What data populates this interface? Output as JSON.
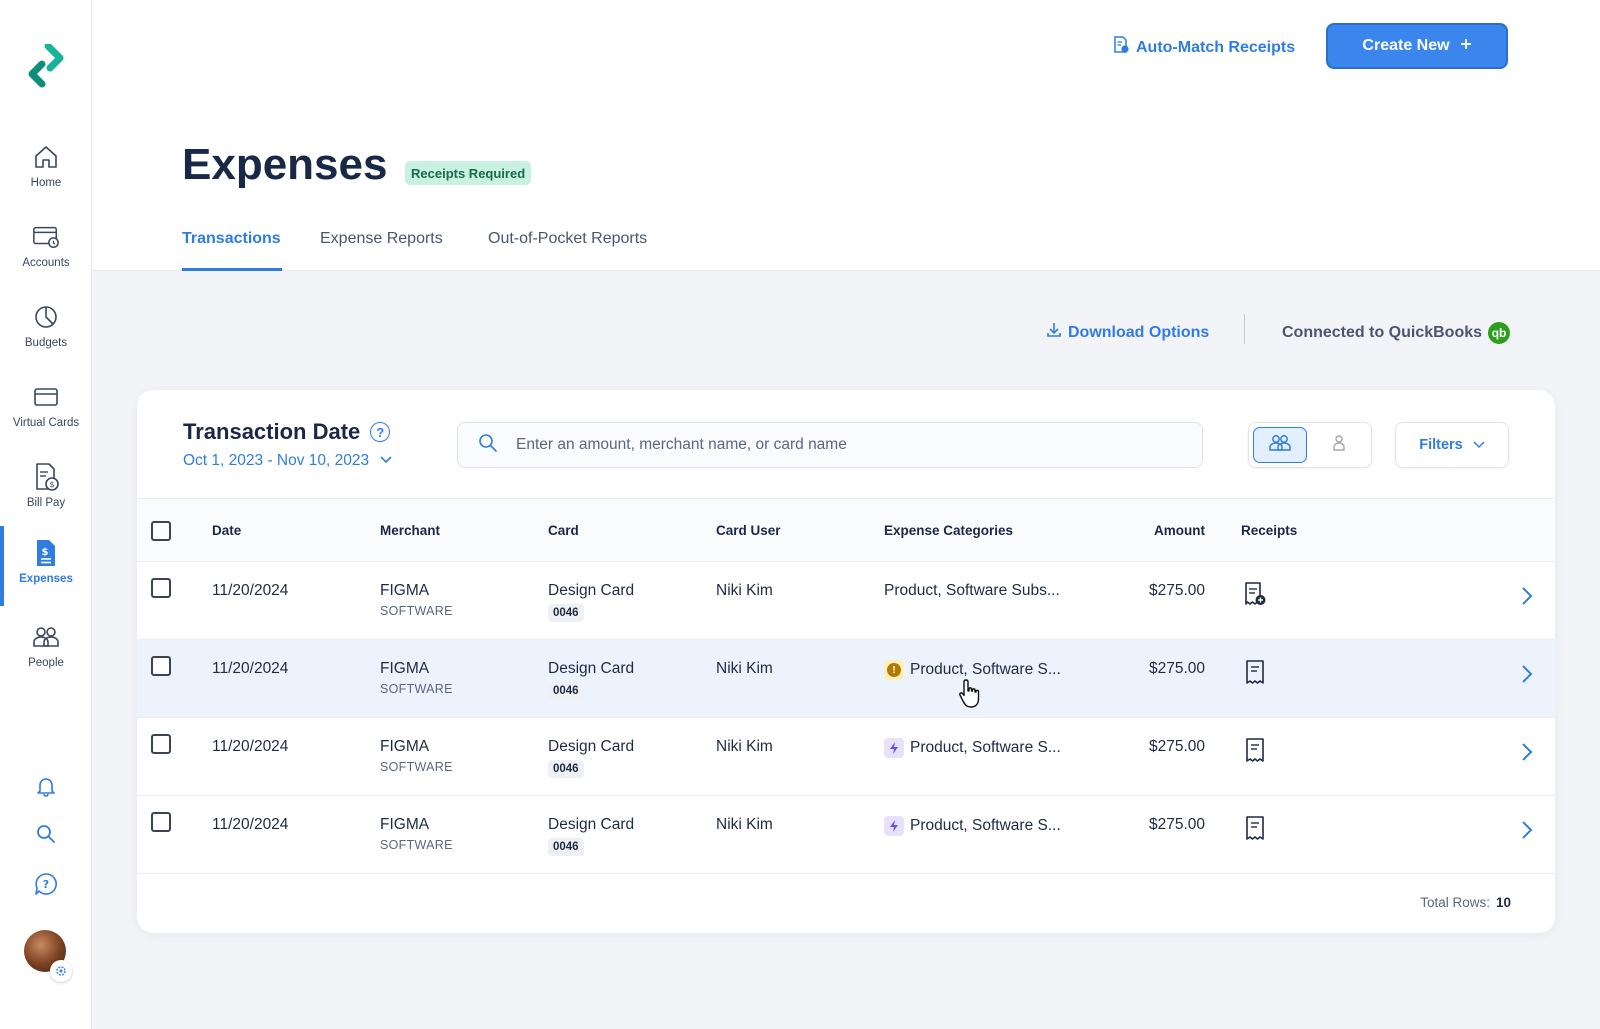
{
  "sidebar": {
    "items": [
      {
        "label": "Home",
        "icon": "home-icon"
      },
      {
        "label": "Accounts",
        "icon": "accounts-icon"
      },
      {
        "label": "Budgets",
        "icon": "pie-chart-icon"
      },
      {
        "label": "Virtual Cards",
        "icon": "credit-card-icon"
      },
      {
        "label": "Bill Pay",
        "icon": "bill-icon"
      },
      {
        "label": "Expenses",
        "icon": "expense-document-icon"
      },
      {
        "label": "People",
        "icon": "people-icon"
      }
    ],
    "active": "Expenses"
  },
  "header": {
    "auto_match_label": "Auto-Match Receipts",
    "create_new_label": "Create New",
    "title": "Expenses",
    "badge": "Receipts Required",
    "tabs": [
      "Transactions",
      "Expense Reports",
      "Out-of-Pocket Reports"
    ],
    "active_tab": "Transactions"
  },
  "actions": {
    "download_label": "Download Options",
    "connection_label": "Connected to QuickBooks",
    "qb_logo_text": "qb"
  },
  "filter": {
    "title": "Transaction Date",
    "help": "?",
    "range": "Oct 1, 2023 - Nov 10, 2023",
    "search_placeholder": "Enter an amount, merchant name, or card name",
    "filters_label": "Filters"
  },
  "table": {
    "columns": [
      "Date",
      "Merchant",
      "Card",
      "Card User",
      "Expense Categories",
      "Amount",
      "Receipts"
    ],
    "rows": [
      {
        "date": "11/20/2024",
        "merchant": "FIGMA",
        "merchant_type": "SOFTWARE",
        "card": "Design Card",
        "card_last4": "0046",
        "user": "Niki Kim",
        "category": "Product, Software Subs...",
        "category_flag": "none",
        "amount": "$275.00",
        "receipt": "receipt-add-icon"
      },
      {
        "date": "11/20/2024",
        "merchant": "FIGMA",
        "merchant_type": "SOFTWARE",
        "card": "Design Card",
        "card_last4": "0046",
        "user": "Niki Kim",
        "category": "Product, Software S...",
        "category_flag": "warning",
        "amount": "$275.00",
        "receipt": "receipt-icon"
      },
      {
        "date": "11/20/2024",
        "merchant": "FIGMA",
        "merchant_type": "SOFTWARE",
        "card": "Design Card",
        "card_last4": "0046",
        "user": "Niki Kim",
        "category": "Product, Software S...",
        "category_flag": "auto",
        "amount": "$275.00",
        "receipt": "receipt-icon"
      },
      {
        "date": "11/20/2024",
        "merchant": "FIGMA",
        "merchant_type": "SOFTWARE",
        "card": "Design Card",
        "card_last4": "0046",
        "user": "Niki Kim",
        "category": "Product, Software S...",
        "category_flag": "auto",
        "amount": "$275.00",
        "receipt": "receipt-icon"
      }
    ],
    "total_label": "Total Rows:",
    "total_value": "10"
  },
  "colors": {
    "accent": "#2f7de1",
    "brand": "#14b39a",
    "quickbooks": "#2ca01c",
    "badge_bg": "#c8f1e1"
  }
}
